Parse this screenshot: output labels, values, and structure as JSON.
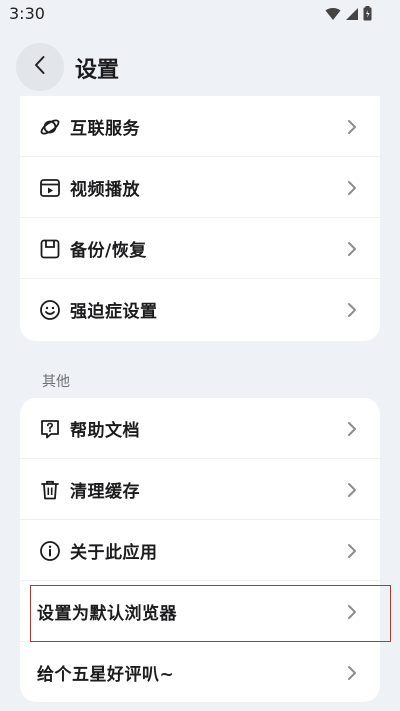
{
  "status_bar": {
    "time": "3:30",
    "icons": [
      "wifi-icon",
      "signal-icon",
      "battery-icon"
    ]
  },
  "header": {
    "back_icon": "chevron-left-icon",
    "title": "设置"
  },
  "group_top": {
    "items": [
      {
        "label": "互联服务",
        "icon": "planet-icon"
      },
      {
        "label": "视频播放",
        "icon": "video-icon"
      },
      {
        "label": "备份/恢复",
        "icon": "save-icon"
      },
      {
        "label": "强迫症设置",
        "icon": "smiley-icon"
      }
    ]
  },
  "section_other": {
    "title": "其他",
    "items": [
      {
        "label": "帮助文档",
        "icon": "help-icon"
      },
      {
        "label": "清理缓存",
        "icon": "trash-icon"
      },
      {
        "label": "关于此应用",
        "icon": "info-icon"
      },
      {
        "label": "设置为默认浏览器",
        "icon": ""
      },
      {
        "label": "给个五星好评叭~",
        "icon": ""
      }
    ]
  },
  "colors": {
    "background": "#eef1f6",
    "card": "#ffffff",
    "highlight": "#b03a32",
    "chevron": "#8a8d93"
  }
}
